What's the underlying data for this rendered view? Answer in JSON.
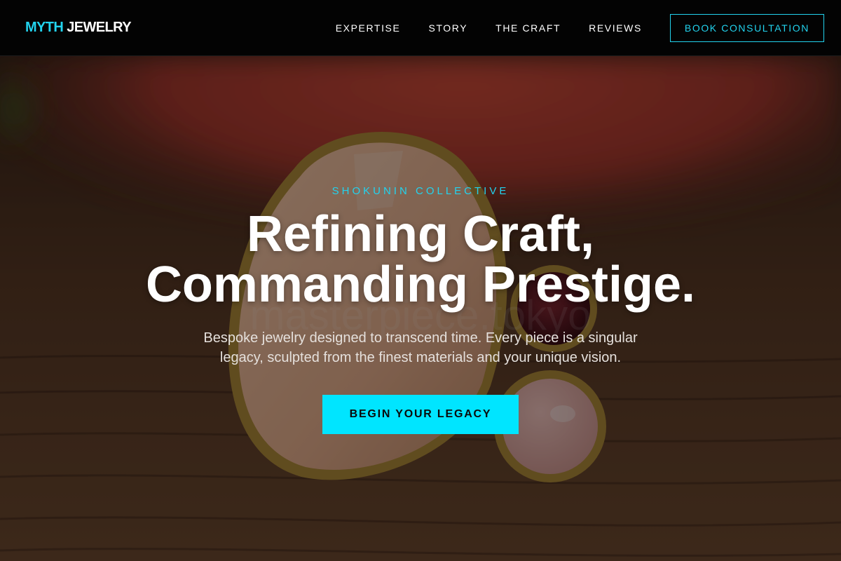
{
  "nav": {
    "logo_accent": "MYTH",
    "logo_rest": " JEWELRY",
    "links": [
      {
        "label": "EXPERTISE"
      },
      {
        "label": "STORY"
      },
      {
        "label": "THE CRAFT"
      },
      {
        "label": "REVIEWS"
      }
    ],
    "cta_label": "BOOK CONSULTATION"
  },
  "hero": {
    "eyebrow": "SHOKUNIN COLLECTIVE",
    "headline_line1": "Refining Craft,",
    "headline_line2": "Commanding Prestige.",
    "subtext": "Bespoke jewelry designed to transcend time. Every piece is a singular legacy, sculpted from the finest materials and your unique vision.",
    "button_label": "BEGIN YOUR LEGACY",
    "watermark": "masterpiece.tokyo"
  },
  "colors": {
    "accent": "#22d3ee",
    "button_bg": "#00e5ff",
    "nav_bg": "#030303"
  }
}
